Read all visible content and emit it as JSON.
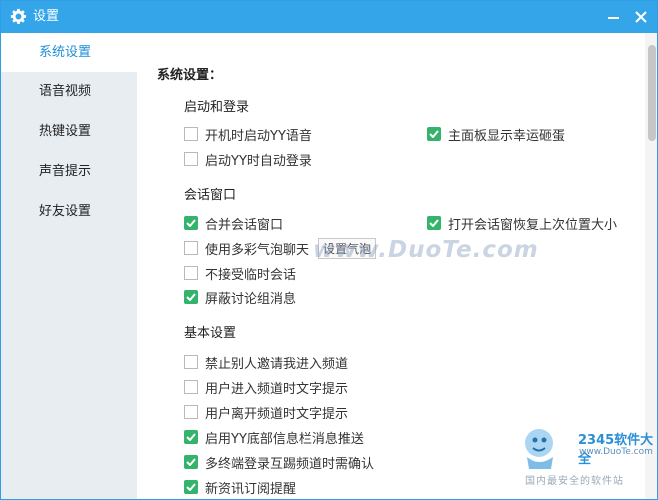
{
  "window": {
    "title": "设置"
  },
  "sidebar": {
    "items": [
      {
        "label": "系统设置",
        "active": true
      },
      {
        "label": "语音视频",
        "active": false
      },
      {
        "label": "热键设置",
        "active": false
      },
      {
        "label": "声音提示",
        "active": false
      },
      {
        "label": "好友设置",
        "active": false
      }
    ]
  },
  "main": {
    "section_title": "系统设置：",
    "groups": [
      {
        "title": "启动和登录",
        "options": [
          {
            "label": "开机时启动YY语音",
            "checked": false
          },
          {
            "label": "主面板显示幸运砸蛋",
            "checked": true
          },
          {
            "label": "启动YY时自动登录",
            "checked": false
          }
        ]
      },
      {
        "title": "会话窗口",
        "options": [
          {
            "label": "合并会话窗口",
            "checked": true
          },
          {
            "label": "打开会话窗恢复上次位置大小",
            "checked": true
          },
          {
            "label": "使用多彩气泡聊天",
            "checked": false
          },
          {
            "label": "不接受临时会话",
            "checked": false
          },
          {
            "label": "屏蔽讨论组消息",
            "checked": true
          }
        ]
      },
      {
        "title": "基本设置",
        "options": [
          {
            "label": "禁止别人邀请我进入频道",
            "checked": false
          },
          {
            "label": "用户进入频道时文字提示",
            "checked": false
          },
          {
            "label": "用户离开频道时文字提示",
            "checked": false
          },
          {
            "label": "启用YY底部信息栏消息推送",
            "checked": true
          },
          {
            "label": "多终端登录互踢频道时需确认",
            "checked": true
          },
          {
            "label": "新资讯订阅提醒",
            "checked": true
          }
        ]
      }
    ],
    "bubble_settings_label": "设置气泡"
  },
  "watermark": {
    "site": "www.DuoTe.com",
    "brand": "2345软件大全",
    "brand_url": "www.DuoTe.com",
    "brand_sub": "国内最安全的软件站"
  },
  "colors": {
    "titlebar": "#35a5ea",
    "accent": "#1e8fd8",
    "check": "#33b36b",
    "sidebar": "#e8edf1"
  },
  "icons": {
    "title": "gear-icon",
    "minimize": "minimize-icon",
    "close": "close-icon",
    "check": "check-icon"
  }
}
